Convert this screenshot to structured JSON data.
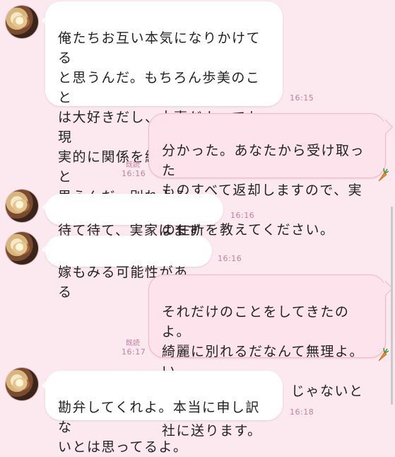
{
  "messages": [
    {
      "side": "in",
      "text": "俺たちお互い本気になりかけてる\nと思うんだ。もちろん歩美のこと\nは大好きだし、大事だよ。でも現\n実的に関係を続けるのは難しいと\n思うんだ。別れよう。",
      "time": "16:15"
    },
    {
      "side": "out",
      "text": "分かった。あなたから受け取った\nものすべて返却しますので、実家\nの住所を教えてください。",
      "read": "既読",
      "time": "16:16"
    },
    {
      "side": "in",
      "text": "待て待て、実家はまずい",
      "time": "16:16"
    },
    {
      "side": "in",
      "text": "嫁もみる可能性がある",
      "time": "16:16"
    },
    {
      "side": "out",
      "text": "それだけのことをしてきたのよ。\n綺麗に別れるだなんて無理よ。い\nいから住所教えて。じゃないと会\n社に送ります。",
      "read": "既読",
      "time": "16:17"
    },
    {
      "side": "in",
      "text": "勘弁してくれよ。本当に申し訳な\nいとは思ってるよ。",
      "time": "16:18"
    }
  ],
  "colors": {
    "background": "#fbe9ef",
    "incoming_bubble": "#ffffff",
    "outgoing_bubble": "#fde3ec",
    "outgoing_border": "#f2b7c9",
    "timestamp": "#c77e9a"
  },
  "icons": {
    "avatar": "food-photo-avatar",
    "sticker": "carrot-icon"
  }
}
